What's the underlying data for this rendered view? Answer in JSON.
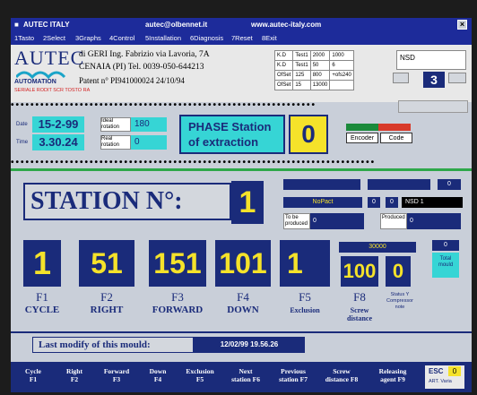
{
  "title_bar": {
    "app": "AUTEC ITALY",
    "email": "autec@olbennet.it",
    "web": "www.autec-italy.com"
  },
  "menu": [
    "1Tasto",
    "2Select",
    "3Graphs",
    "4Control",
    "5Installation",
    "6Diagnosis",
    "7Reset",
    "8Exit"
  ],
  "company": {
    "logo_text": "AUTEC",
    "logo_sub": "AUTOMATION",
    "line1": "di GERI Ing. Fabrizio via Lavoria, 7A",
    "line2": "CENAIA (PI) Tel. 0039-050-644213",
    "line3": "Patent n° PI941000024 24/10/94",
    "red_text": "SERIALE RODIT SCR TOSTO RA"
  },
  "kd_table": [
    [
      "K.D",
      "Test1",
      "2000",
      "1000"
    ],
    [
      "K.D",
      "Test1",
      "50",
      "6"
    ],
    [
      "OfSet",
      "125",
      "800",
      "+ofs240"
    ],
    [
      "OfSet",
      "15",
      "13000",
      ""
    ]
  ],
  "nsd_label": "NSD",
  "nsd_value": "3",
  "date": {
    "label": "Date",
    "value": "15-2-99"
  },
  "time": {
    "label": "Time",
    "value": "3.30.24"
  },
  "ideal_rotation": {
    "label": "Ideal rotation",
    "value": "180"
  },
  "real_rotation": {
    "label": "Real rotation",
    "value": "0"
  },
  "phase": {
    "line1": "PHASE Station",
    "line2": "of  extraction",
    "value": "0"
  },
  "encoder_label": "Encoder",
  "code_label": "Code",
  "station": {
    "label": "STATION  N°:",
    "value": "1"
  },
  "right_panel": {
    "nopact": "NoPact",
    "nopact_v1": "0",
    "nopact_v2": "0",
    "nsd1": "NSD 1",
    "top_right_value": "0",
    "to_be_produced_label": "To be produced",
    "to_be_produced_value": "0",
    "produced_label": "Produced",
    "produced_value": "0",
    "bar_value": "30000",
    "side_value": "0",
    "total_label": "Total mould"
  },
  "tiles": [
    {
      "value": "1",
      "key": "F1",
      "label": "CYCLE"
    },
    {
      "value": "51",
      "key": "F2",
      "label": "RIGHT"
    },
    {
      "value": "151",
      "key": "F3",
      "label": "FORWARD"
    },
    {
      "value": "101",
      "key": "F4",
      "label": "DOWN"
    },
    {
      "value": "1",
      "key": "F5",
      "label": "Exclusion"
    },
    {
      "value": "100",
      "key": "F8",
      "label": "Screw distance"
    },
    {
      "value": "0",
      "key": "",
      "label": "Status Y Compressor note"
    }
  ],
  "last_modify": {
    "label": "Last modify of this mould:",
    "value": "12/02/99 19.56.26"
  },
  "fkeys": [
    {
      "l1": "Cycle",
      "l2": "F1"
    },
    {
      "l1": "Right",
      "l2": "F2"
    },
    {
      "l1": "Forward",
      "l2": "F3"
    },
    {
      "l1": "Down",
      "l2": "F4"
    },
    {
      "l1": "Exclusion",
      "l2": "F5"
    },
    {
      "l1": "Next",
      "l2": "station F6"
    },
    {
      "l1": "Previous",
      "l2": "station F7"
    },
    {
      "l1": "Screw",
      "l2": "distance F8"
    },
    {
      "l1": "Releasing",
      "l2": "agent F9"
    }
  ],
  "esc": {
    "label": "ESC",
    "value": "0",
    "sub": "ART. Varia"
  }
}
